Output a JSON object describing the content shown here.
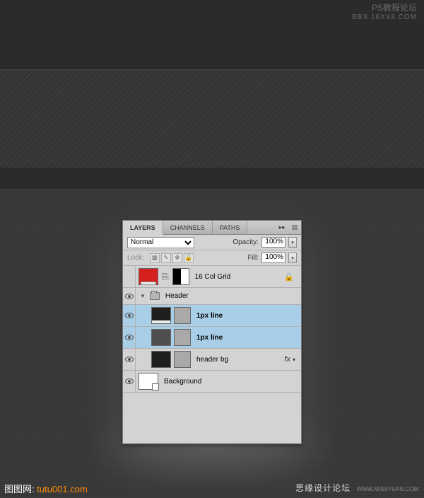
{
  "watermarks": {
    "tr1": "PS教程论坛",
    "tr2": "BBS.16XX8.COM",
    "bl_brand": "图图网:",
    "bl_url": "tutu001.com",
    "br_cn": "思缘设计论坛",
    "br_url": "WWW.MISSYUAN.COM"
  },
  "panel": {
    "tabs": {
      "layers": "LAYERS",
      "channels": "CHANNELS",
      "paths": "PATHS"
    },
    "blend_mode": "Normal",
    "opacity_label": "Opacity:",
    "opacity_value": "100%",
    "lock_label": "Lock:",
    "fill_label": "Fill:",
    "fill_value": "100%",
    "layers": {
      "grid": "16 Col Grid",
      "header_group": "Header",
      "line1": "1px line",
      "line2": "1px line",
      "header_bg": "header bg",
      "background": "Background"
    }
  }
}
